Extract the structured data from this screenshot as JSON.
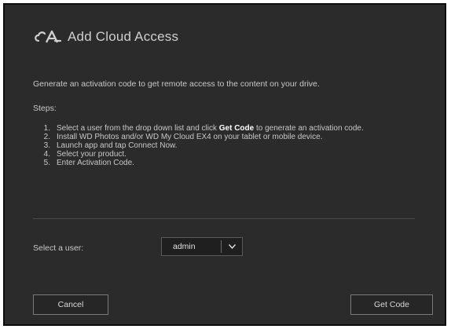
{
  "dialog": {
    "title": "Add Cloud Access",
    "icon": "cloud-link-icon",
    "intro": "Generate an activation code to get remote access to the content on your drive.",
    "steps_label": "Steps:",
    "steps": [
      {
        "num": "1.",
        "pre": "Select a user from the drop down list and click ",
        "bold": "Get Code",
        "post": " to generate an activation code."
      },
      {
        "num": "2.",
        "pre": "Install WD Photos and/or WD My Cloud EX4 on your tablet or mobile device.",
        "bold": "",
        "post": ""
      },
      {
        "num": "3.",
        "pre": "Launch app and tap Connect Now.",
        "bold": "",
        "post": ""
      },
      {
        "num": "4.",
        "pre": "Select your product.",
        "bold": "",
        "post": ""
      },
      {
        "num": "5.",
        "pre": "Enter Activation Code.",
        "bold": "",
        "post": ""
      }
    ],
    "select_label": "Select a user:",
    "select_value": "admin",
    "cancel_label": "Cancel",
    "getcode_label": "Get Code"
  },
  "colors": {
    "background": "#2b2b2b",
    "text": "#c8c8c8",
    "highlight": "#ffffff"
  }
}
